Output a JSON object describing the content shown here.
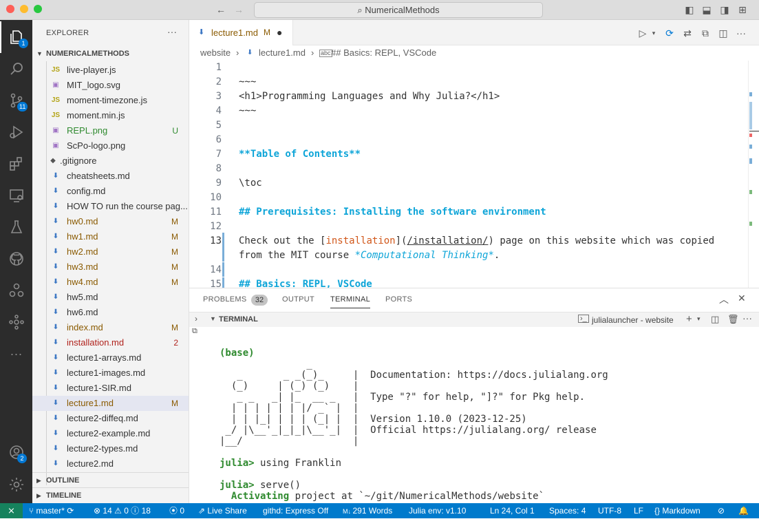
{
  "title_bar": {
    "search_text": "NumericalMethods"
  },
  "activity_bar": {
    "explorer_badge": "1",
    "scm_badge": "11",
    "accounts_badge": "2"
  },
  "sidebar": {
    "header": "EXPLORER",
    "more": "···",
    "root_folder": "NUMERICALMETHODS",
    "files": [
      {
        "icon": "JS",
        "name": "live-player.js",
        "status": "",
        "color": "#333333",
        "icon_color": "#b3a315"
      },
      {
        "icon": "▣",
        "name": "MIT_logo.svg",
        "status": "",
        "color": "#333333",
        "icon_color": "#a074c4"
      },
      {
        "icon": "JS",
        "name": "moment-timezone.js",
        "status": "",
        "color": "#333333",
        "icon_color": "#b3a315"
      },
      {
        "icon": "JS",
        "name": "moment.min.js",
        "status": "",
        "color": "#333333",
        "icon_color": "#b3a315"
      },
      {
        "icon": "▣",
        "name": "REPL.png",
        "status": "U",
        "color": "#2f8a2f",
        "icon_color": "#a074c4"
      },
      {
        "icon": "▣",
        "name": "ScPo-logo.png",
        "status": "",
        "color": "#333333",
        "icon_color": "#a074c4"
      },
      {
        "icon": "◆",
        "name": ".gitignore",
        "status": "",
        "color": "#333333",
        "icon_color": "#555555"
      },
      {
        "icon": "⬇",
        "name": "cheatsheets.md",
        "status": "",
        "color": "#333333",
        "icon_color": "#3d78c4"
      },
      {
        "icon": "⬇",
        "name": "config.md",
        "status": "",
        "color": "#333333",
        "icon_color": "#3d78c4"
      },
      {
        "icon": "⬇",
        "name": "HOW TO run the course pag...",
        "status": "",
        "color": "#333333",
        "icon_color": "#3d78c4"
      },
      {
        "icon": "⬇",
        "name": "hw0.md",
        "status": "M",
        "color": "#8a5a00",
        "icon_color": "#3d78c4"
      },
      {
        "icon": "⬇",
        "name": "hw1.md",
        "status": "M",
        "color": "#8a5a00",
        "icon_color": "#3d78c4"
      },
      {
        "icon": "⬇",
        "name": "hw2.md",
        "status": "M",
        "color": "#8a5a00",
        "icon_color": "#3d78c4"
      },
      {
        "icon": "⬇",
        "name": "hw3.md",
        "status": "M",
        "color": "#8a5a00",
        "icon_color": "#3d78c4"
      },
      {
        "icon": "⬇",
        "name": "hw4.md",
        "status": "M",
        "color": "#8a5a00",
        "icon_color": "#3d78c4"
      },
      {
        "icon": "⬇",
        "name": "hw5.md",
        "status": "",
        "color": "#333333",
        "icon_color": "#3d78c4"
      },
      {
        "icon": "⬇",
        "name": "hw6.md",
        "status": "",
        "color": "#333333",
        "icon_color": "#3d78c4"
      },
      {
        "icon": "⬇",
        "name": "index.md",
        "status": "M",
        "color": "#8a5a00",
        "icon_color": "#3d78c4"
      },
      {
        "icon": "⬇",
        "name": "installation.md",
        "status": "2",
        "color": "#b0221c",
        "icon_color": "#3d78c4"
      },
      {
        "icon": "⬇",
        "name": "lecture1-arrays.md",
        "status": "",
        "color": "#333333",
        "icon_color": "#3d78c4"
      },
      {
        "icon": "⬇",
        "name": "lecture1-images.md",
        "status": "",
        "color": "#333333",
        "icon_color": "#3d78c4"
      },
      {
        "icon": "⬇",
        "name": "lecture1-SIR.md",
        "status": "",
        "color": "#333333",
        "icon_color": "#3d78c4"
      },
      {
        "icon": "⬇",
        "name": "lecture1.md",
        "status": "M",
        "color": "#8a5a00",
        "icon_color": "#3d78c4",
        "selected": true
      },
      {
        "icon": "⬇",
        "name": "lecture2-diffeq.md",
        "status": "",
        "color": "#333333",
        "icon_color": "#3d78c4"
      },
      {
        "icon": "⬇",
        "name": "lecture2-example.md",
        "status": "",
        "color": "#333333",
        "icon_color": "#3d78c4"
      },
      {
        "icon": "⬇",
        "name": "lecture2-types.md",
        "status": "",
        "color": "#333333",
        "icon_color": "#3d78c4"
      },
      {
        "icon": "⬇",
        "name": "lecture2.md",
        "status": "",
        "color": "#333333",
        "icon_color": "#3d78c4"
      }
    ],
    "outline_label": "OUTLINE",
    "timeline_label": "TIMELINE"
  },
  "editor": {
    "tab_label": "lecture1.md",
    "tab_status": "M",
    "breadcrumb": {
      "folder": "website",
      "file": "lecture1.md",
      "symbol": "## Basics: REPL, VSCode"
    },
    "lines": [
      {
        "n": "1",
        "text": ""
      },
      {
        "n": "2",
        "text": "~~~"
      },
      {
        "n": "3",
        "text": "<h1>Programming Languages and Why Julia?</h1>"
      },
      {
        "n": "4",
        "text": "~~~"
      },
      {
        "n": "5",
        "text": ""
      },
      {
        "n": "6",
        "text": ""
      },
      {
        "n": "7",
        "text": "**Table of Contents**",
        "style": "hd"
      },
      {
        "n": "8",
        "text": ""
      },
      {
        "n": "9",
        "text": "\\toc"
      },
      {
        "n": "10",
        "text": ""
      },
      {
        "n": "11",
        "text": "## Prerequisites: Installing the software environment",
        "style": "hd"
      },
      {
        "n": "12",
        "text": ""
      },
      {
        "n": "13",
        "parts": [
          "Check out the [",
          "installation",
          "](",
          "/installation/",
          ") page on this website which was copied"
        ]
      },
      {
        "n": "",
        "parts2": [
          "from the MIT course ",
          "*Computational Thinking*",
          "."
        ]
      },
      {
        "n": "14",
        "text": ""
      },
      {
        "n": "15",
        "text": "## Basics: REPL, VSCode",
        "style": "hd"
      }
    ]
  },
  "panel": {
    "tabs": [
      "PROBLEMS",
      "OUTPUT",
      "TERMINAL",
      "PORTS"
    ],
    "problems_count": "32",
    "terminal_header": "TERMINAL",
    "terminal_instance": "julialauncher - website",
    "terminal_lines": [
      "(base)",
      "               _",
      "   _       _ _(_)_     |  Documentation: https://docs.julialang.org",
      "  (_)     | (_) (_)    |",
      "   _ _   _| |_  __ _   |  Type \"?\" for help, \"]?\" for Pkg help.",
      "  | | | | | | |/ _` |  |",
      "  | | |_| | | | (_| |  |  Version 1.10.0 (2023-12-25)",
      " _/ |\\__'_|_|_|\\__'_|  |  Official https://julialang.org/ release",
      "|__/                   |",
      "",
      "julia> using Franklin",
      "",
      "julia> serve()",
      "  Activating project at `~/git/NumericalMethods/website`"
    ]
  },
  "status_bar": {
    "branch": "master*",
    "errors": "14",
    "warnings": "0",
    "infos": "18",
    "ports": "0",
    "live_share": "Live Share",
    "githd": "githd: Express Off",
    "words": "291 Words",
    "julia_env": "Julia env: v1.10",
    "position": "Ln 24, Col 1",
    "spaces": "Spaces: 4",
    "encoding": "UTF-8",
    "eol": "LF",
    "language": "Markdown"
  },
  "colors": {
    "accent": "#007acc",
    "heading": "#0ea5d8",
    "link": "#d1571a",
    "julia_green": "#2f8a2f"
  }
}
